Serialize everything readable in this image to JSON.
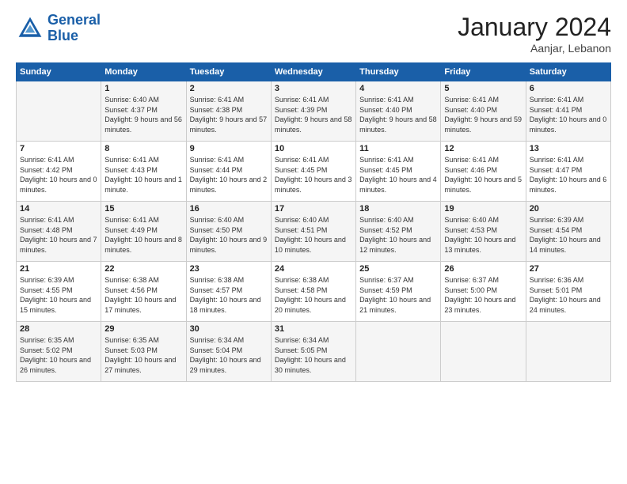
{
  "logo": {
    "line1": "General",
    "line2": "Blue"
  },
  "title": "January 2024",
  "location": "Aanjar, Lebanon",
  "header_days": [
    "Sunday",
    "Monday",
    "Tuesday",
    "Wednesday",
    "Thursday",
    "Friday",
    "Saturday"
  ],
  "weeks": [
    [
      {
        "day": "",
        "sunrise": "",
        "sunset": "",
        "daylight": ""
      },
      {
        "day": "1",
        "sunrise": "Sunrise: 6:40 AM",
        "sunset": "Sunset: 4:37 PM",
        "daylight": "Daylight: 9 hours and 56 minutes."
      },
      {
        "day": "2",
        "sunrise": "Sunrise: 6:41 AM",
        "sunset": "Sunset: 4:38 PM",
        "daylight": "Daylight: 9 hours and 57 minutes."
      },
      {
        "day": "3",
        "sunrise": "Sunrise: 6:41 AM",
        "sunset": "Sunset: 4:39 PM",
        "daylight": "Daylight: 9 hours and 58 minutes."
      },
      {
        "day": "4",
        "sunrise": "Sunrise: 6:41 AM",
        "sunset": "Sunset: 4:40 PM",
        "daylight": "Daylight: 9 hours and 58 minutes."
      },
      {
        "day": "5",
        "sunrise": "Sunrise: 6:41 AM",
        "sunset": "Sunset: 4:40 PM",
        "daylight": "Daylight: 9 hours and 59 minutes."
      },
      {
        "day": "6",
        "sunrise": "Sunrise: 6:41 AM",
        "sunset": "Sunset: 4:41 PM",
        "daylight": "Daylight: 10 hours and 0 minutes."
      }
    ],
    [
      {
        "day": "7",
        "sunrise": "Sunrise: 6:41 AM",
        "sunset": "Sunset: 4:42 PM",
        "daylight": "Daylight: 10 hours and 0 minutes."
      },
      {
        "day": "8",
        "sunrise": "Sunrise: 6:41 AM",
        "sunset": "Sunset: 4:43 PM",
        "daylight": "Daylight: 10 hours and 1 minute."
      },
      {
        "day": "9",
        "sunrise": "Sunrise: 6:41 AM",
        "sunset": "Sunset: 4:44 PM",
        "daylight": "Daylight: 10 hours and 2 minutes."
      },
      {
        "day": "10",
        "sunrise": "Sunrise: 6:41 AM",
        "sunset": "Sunset: 4:45 PM",
        "daylight": "Daylight: 10 hours and 3 minutes."
      },
      {
        "day": "11",
        "sunrise": "Sunrise: 6:41 AM",
        "sunset": "Sunset: 4:45 PM",
        "daylight": "Daylight: 10 hours and 4 minutes."
      },
      {
        "day": "12",
        "sunrise": "Sunrise: 6:41 AM",
        "sunset": "Sunset: 4:46 PM",
        "daylight": "Daylight: 10 hours and 5 minutes."
      },
      {
        "day": "13",
        "sunrise": "Sunrise: 6:41 AM",
        "sunset": "Sunset: 4:47 PM",
        "daylight": "Daylight: 10 hours and 6 minutes."
      }
    ],
    [
      {
        "day": "14",
        "sunrise": "Sunrise: 6:41 AM",
        "sunset": "Sunset: 4:48 PM",
        "daylight": "Daylight: 10 hours and 7 minutes."
      },
      {
        "day": "15",
        "sunrise": "Sunrise: 6:41 AM",
        "sunset": "Sunset: 4:49 PM",
        "daylight": "Daylight: 10 hours and 8 minutes."
      },
      {
        "day": "16",
        "sunrise": "Sunrise: 6:40 AM",
        "sunset": "Sunset: 4:50 PM",
        "daylight": "Daylight: 10 hours and 9 minutes."
      },
      {
        "day": "17",
        "sunrise": "Sunrise: 6:40 AM",
        "sunset": "Sunset: 4:51 PM",
        "daylight": "Daylight: 10 hours and 10 minutes."
      },
      {
        "day": "18",
        "sunrise": "Sunrise: 6:40 AM",
        "sunset": "Sunset: 4:52 PM",
        "daylight": "Daylight: 10 hours and 12 minutes."
      },
      {
        "day": "19",
        "sunrise": "Sunrise: 6:40 AM",
        "sunset": "Sunset: 4:53 PM",
        "daylight": "Daylight: 10 hours and 13 minutes."
      },
      {
        "day": "20",
        "sunrise": "Sunrise: 6:39 AM",
        "sunset": "Sunset: 4:54 PM",
        "daylight": "Daylight: 10 hours and 14 minutes."
      }
    ],
    [
      {
        "day": "21",
        "sunrise": "Sunrise: 6:39 AM",
        "sunset": "Sunset: 4:55 PM",
        "daylight": "Daylight: 10 hours and 15 minutes."
      },
      {
        "day": "22",
        "sunrise": "Sunrise: 6:38 AM",
        "sunset": "Sunset: 4:56 PM",
        "daylight": "Daylight: 10 hours and 17 minutes."
      },
      {
        "day": "23",
        "sunrise": "Sunrise: 6:38 AM",
        "sunset": "Sunset: 4:57 PM",
        "daylight": "Daylight: 10 hours and 18 minutes."
      },
      {
        "day": "24",
        "sunrise": "Sunrise: 6:38 AM",
        "sunset": "Sunset: 4:58 PM",
        "daylight": "Daylight: 10 hours and 20 minutes."
      },
      {
        "day": "25",
        "sunrise": "Sunrise: 6:37 AM",
        "sunset": "Sunset: 4:59 PM",
        "daylight": "Daylight: 10 hours and 21 minutes."
      },
      {
        "day": "26",
        "sunrise": "Sunrise: 6:37 AM",
        "sunset": "Sunset: 5:00 PM",
        "daylight": "Daylight: 10 hours and 23 minutes."
      },
      {
        "day": "27",
        "sunrise": "Sunrise: 6:36 AM",
        "sunset": "Sunset: 5:01 PM",
        "daylight": "Daylight: 10 hours and 24 minutes."
      }
    ],
    [
      {
        "day": "28",
        "sunrise": "Sunrise: 6:35 AM",
        "sunset": "Sunset: 5:02 PM",
        "daylight": "Daylight: 10 hours and 26 minutes."
      },
      {
        "day": "29",
        "sunrise": "Sunrise: 6:35 AM",
        "sunset": "Sunset: 5:03 PM",
        "daylight": "Daylight: 10 hours and 27 minutes."
      },
      {
        "day": "30",
        "sunrise": "Sunrise: 6:34 AM",
        "sunset": "Sunset: 5:04 PM",
        "daylight": "Daylight: 10 hours and 29 minutes."
      },
      {
        "day": "31",
        "sunrise": "Sunrise: 6:34 AM",
        "sunset": "Sunset: 5:05 PM",
        "daylight": "Daylight: 10 hours and 30 minutes."
      },
      {
        "day": "",
        "sunrise": "",
        "sunset": "",
        "daylight": ""
      },
      {
        "day": "",
        "sunrise": "",
        "sunset": "",
        "daylight": ""
      },
      {
        "day": "",
        "sunrise": "",
        "sunset": "",
        "daylight": ""
      }
    ]
  ]
}
